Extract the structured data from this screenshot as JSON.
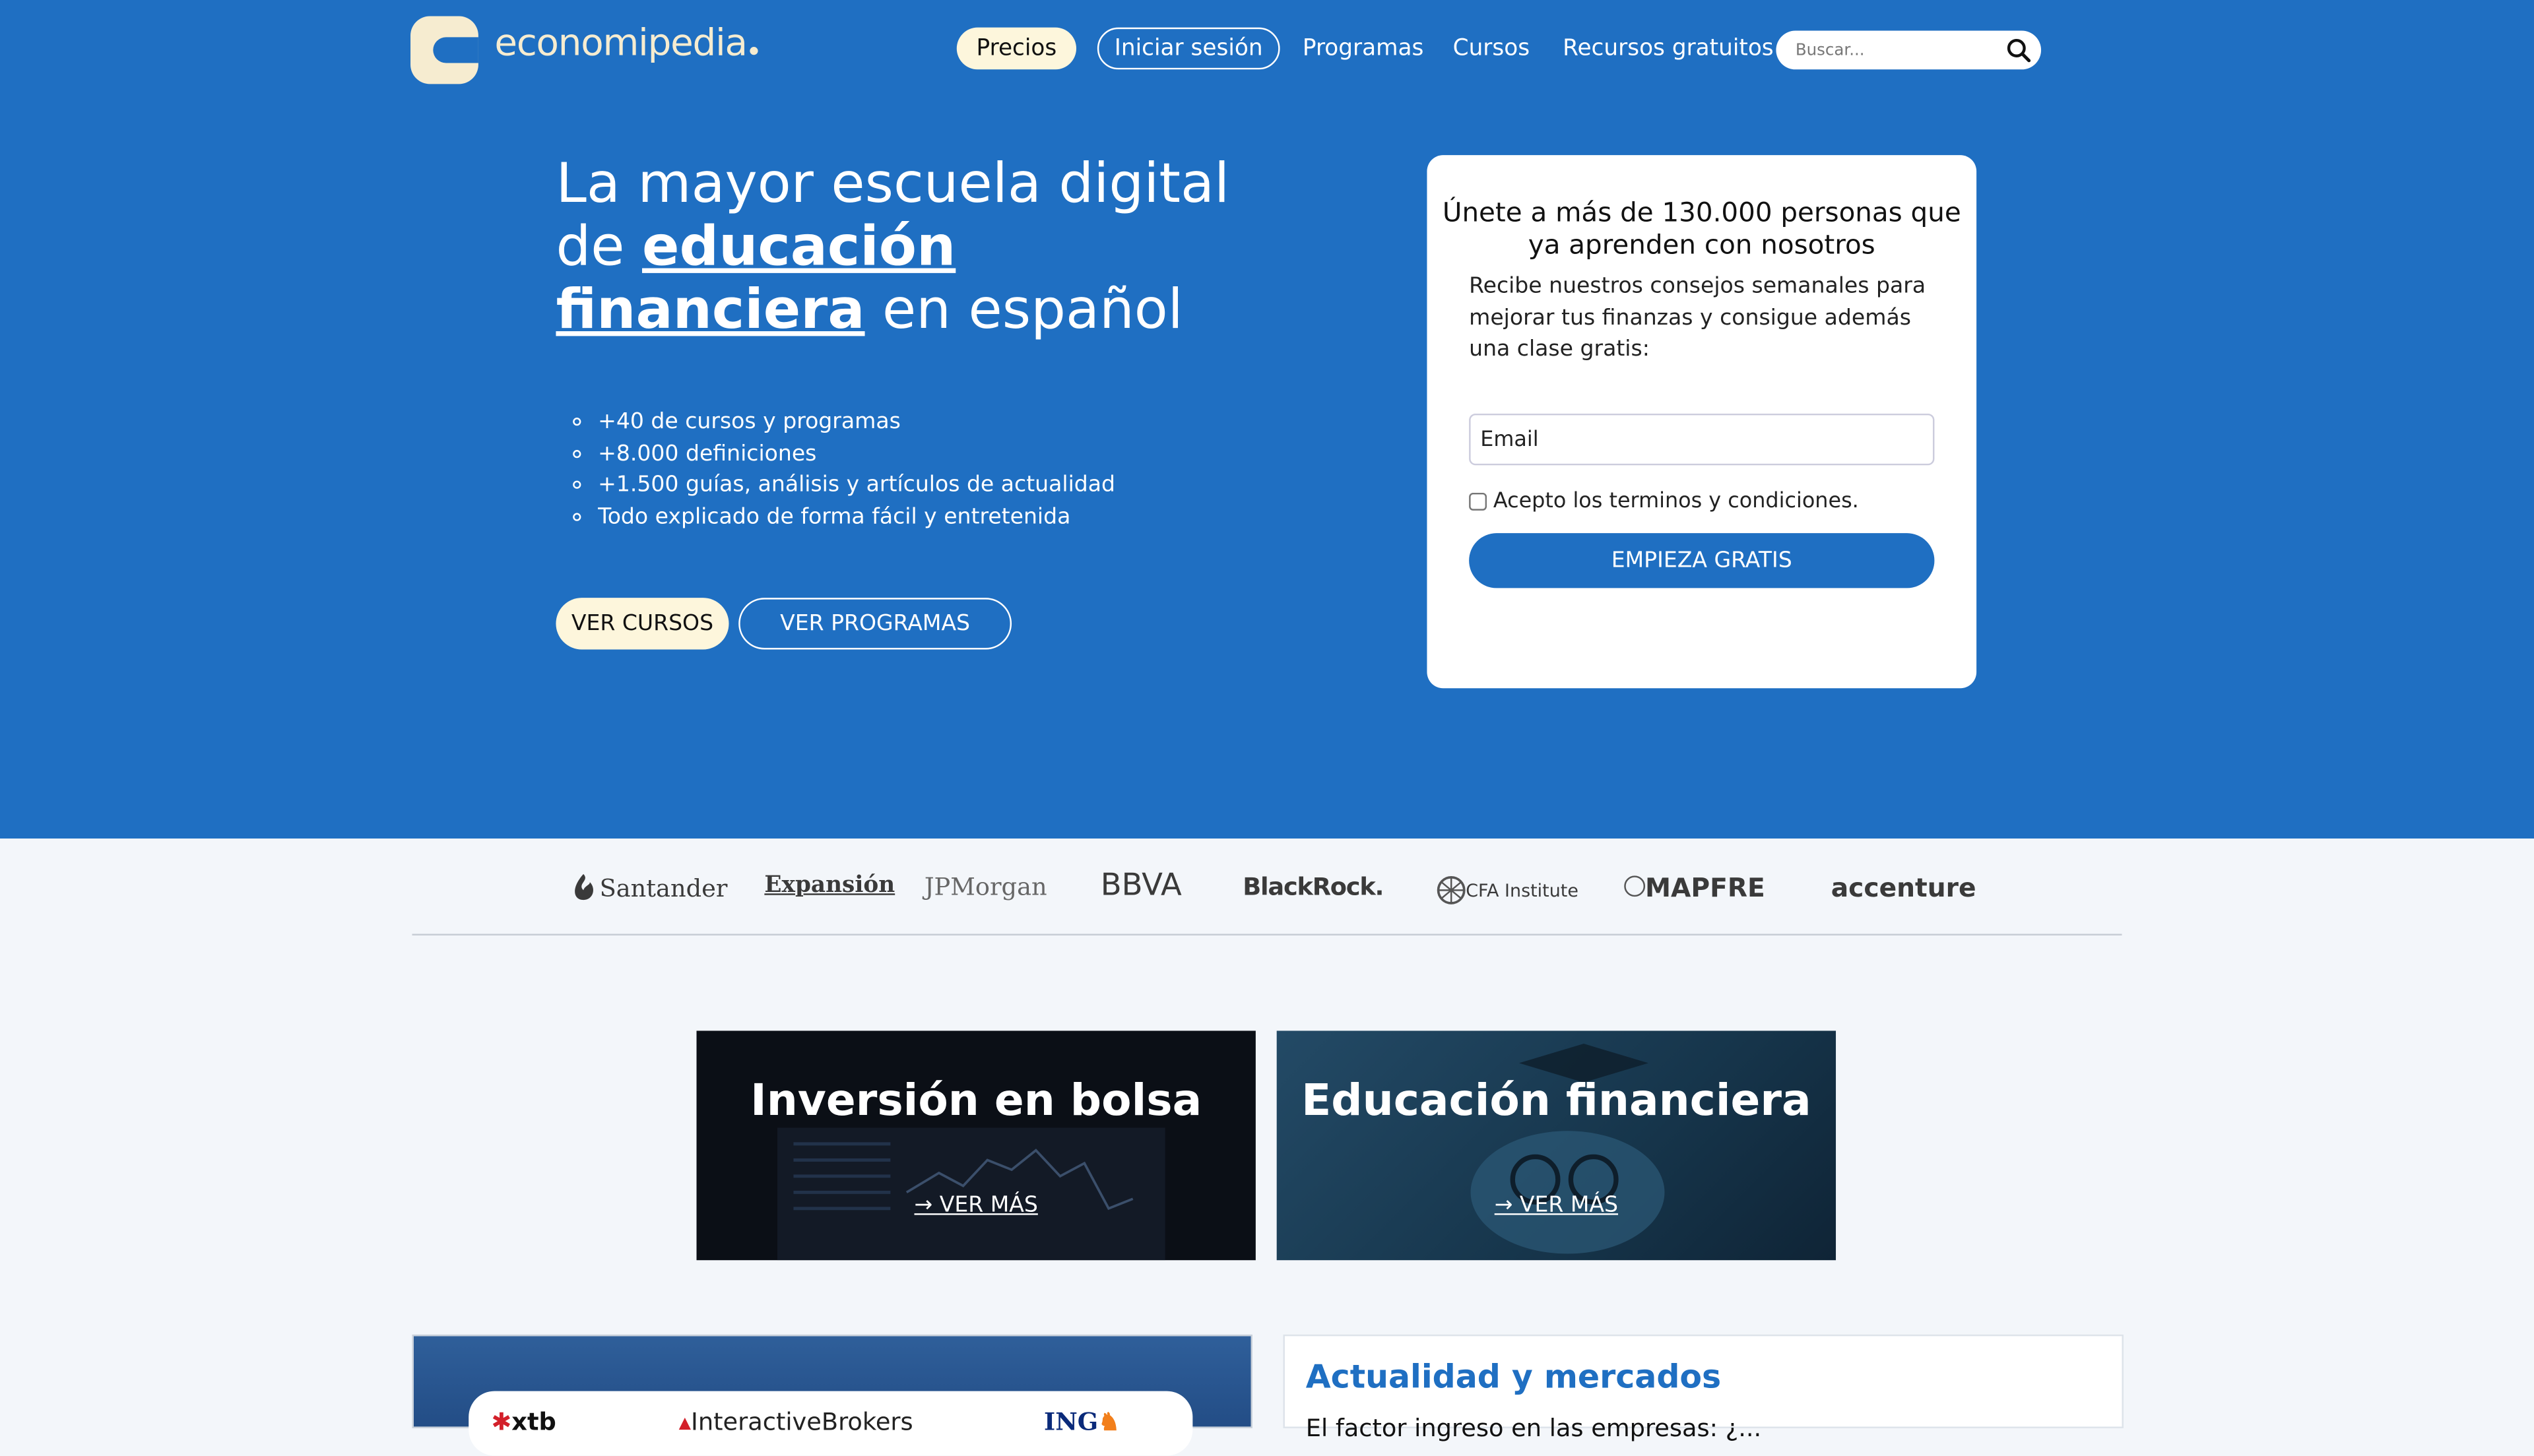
{
  "header": {
    "logo_text": "economipedia",
    "nav": {
      "precios": "Precios",
      "login": "Iniciar sesión",
      "programas": "Programas",
      "cursos": "Cursos",
      "recursos": "Recursos gratuitos"
    },
    "search": {
      "placeholder": "Buscar...",
      "icon": "search-icon"
    }
  },
  "hero": {
    "title_pre": "La mayor escuela digital de ",
    "title_link": "educación financiera",
    "title_post": " en español",
    "features": [
      "+40 de cursos y programas",
      "+8.000 definiciones",
      "+1.500 guías, análisis y artículos de actualidad",
      "Todo explicado de forma fácil y entretenida"
    ],
    "cta_cursos": "VER CURSOS",
    "cta_programas": "VER PROGRAMAS"
  },
  "signup": {
    "title": "Únete a más de 130.000 personas que ya aprenden con nosotros",
    "description": "Recibe nuestros consejos semanales para mejorar tus finanzas y consigue además una clase gratis:",
    "email_placeholder": "Email",
    "terms_label": "Acepto los terminos y condiciones.",
    "submit": "EMPIEZA GRATIS"
  },
  "partners": [
    "Santander",
    "Expansión",
    "JPMorgan",
    "BBVA",
    "BlackRock.",
    "CFA Institute",
    "MAPFRE",
    "accenture"
  ],
  "tiles": [
    {
      "title": "Inversión en bolsa",
      "link": "→ VER MÁS"
    },
    {
      "title": "Educación financiera",
      "link": "→ VER MÁS"
    }
  ],
  "brokers": [
    "xtb",
    "InteractiveBrokers",
    "ING"
  ],
  "news": {
    "title": "Actualidad y mercados",
    "snippet": "El factor ingreso en las empresas: ¿..."
  },
  "colors": {
    "brand_blue": "#1f6fc2",
    "cream": "#fdf6dc",
    "page_bg": "#f3f6fa"
  }
}
